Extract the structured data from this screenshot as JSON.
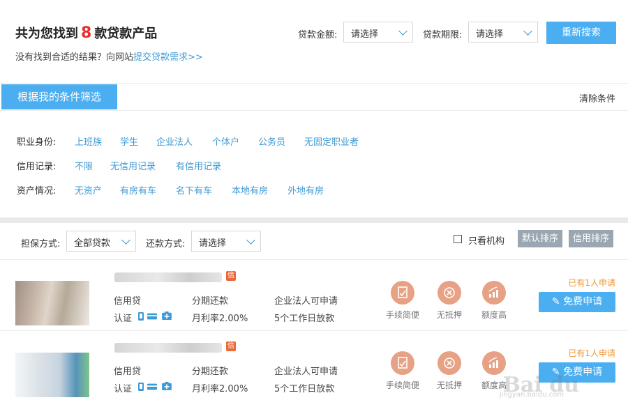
{
  "header": {
    "found_prefix": "共为您找到",
    "found_count": "8",
    "found_suffix": "款贷款产品",
    "sub_text": "没有找到合适的结果？向网站",
    "sub_link": "提交贷款需求>>"
  },
  "search": {
    "amount_label": "贷款金额:",
    "amount_value": "请选择",
    "term_label": "贷款期限:",
    "term_value": "请选择",
    "research_button": "重新搜索"
  },
  "filter": {
    "tab_label": "根据我的条件筛选",
    "clear_label": "清除条件",
    "rows": [
      {
        "key": "职业身份:",
        "options": [
          "上班族",
          "学生",
          "企业法人",
          "个体户",
          "公务员",
          "无固定职业者"
        ]
      },
      {
        "key": "信用记录:",
        "options": [
          "不限",
          "无信用记录",
          "有信用记录"
        ]
      },
      {
        "key": "资产情况:",
        "options": [
          "无资产",
          "有房有车",
          "名下有车",
          "本地有房",
          "外地有房"
        ]
      }
    ]
  },
  "toolbar": {
    "guarantee_label": "担保方式:",
    "guarantee_value": "全部贷款",
    "repay_label": "还款方式:",
    "repay_value": "请选择",
    "only_org_label": "只看机构",
    "sort_default": "默认排序",
    "sort_credit": "信用排序"
  },
  "products": [
    {
      "badge": "信",
      "type": "信用贷",
      "verify": "认证",
      "repay": "分期还款",
      "rate": "月利率2.00%",
      "who": "企业法人可申请",
      "days": "5个工作日放款",
      "features": [
        "手续简便",
        "无抵押",
        "额度高"
      ],
      "applied": "已有1人申请",
      "apply_button": "免费申请"
    },
    {
      "badge": "信",
      "type": "信用贷",
      "verify": "认证",
      "repay": "分期还款",
      "rate": "月利率2.00%",
      "who": "企业法人可申请",
      "days": "5个工作日放款",
      "features": [
        "手续简便",
        "无抵押",
        "额度高"
      ],
      "applied": "已有1人申请",
      "apply_button": "免费申请"
    }
  ],
  "watermark": {
    "brand": "Bai du",
    "url": "jingyan.baidu.com"
  },
  "colors": {
    "accent": "#4aaef0",
    "link": "#3d9ad6",
    "highlight": "#e5302a",
    "feature": "#e7a184",
    "applied": "#f0962e"
  }
}
